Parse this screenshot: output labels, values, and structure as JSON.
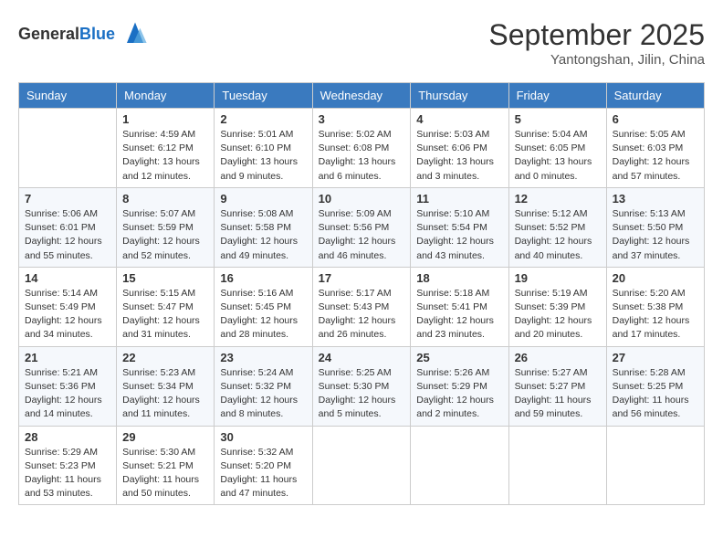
{
  "header": {
    "logo_line1": "General",
    "logo_line2": "Blue",
    "month": "September 2025",
    "location": "Yantongshan, Jilin, China"
  },
  "weekdays": [
    "Sunday",
    "Monday",
    "Tuesday",
    "Wednesday",
    "Thursday",
    "Friday",
    "Saturday"
  ],
  "weeks": [
    [
      {
        "day": "",
        "info": ""
      },
      {
        "day": "1",
        "info": "Sunrise: 4:59 AM\nSunset: 6:12 PM\nDaylight: 13 hours\nand 12 minutes."
      },
      {
        "day": "2",
        "info": "Sunrise: 5:01 AM\nSunset: 6:10 PM\nDaylight: 13 hours\nand 9 minutes."
      },
      {
        "day": "3",
        "info": "Sunrise: 5:02 AM\nSunset: 6:08 PM\nDaylight: 13 hours\nand 6 minutes."
      },
      {
        "day": "4",
        "info": "Sunrise: 5:03 AM\nSunset: 6:06 PM\nDaylight: 13 hours\nand 3 minutes."
      },
      {
        "day": "5",
        "info": "Sunrise: 5:04 AM\nSunset: 6:05 PM\nDaylight: 13 hours\nand 0 minutes."
      },
      {
        "day": "6",
        "info": "Sunrise: 5:05 AM\nSunset: 6:03 PM\nDaylight: 12 hours\nand 57 minutes."
      }
    ],
    [
      {
        "day": "7",
        "info": "Sunrise: 5:06 AM\nSunset: 6:01 PM\nDaylight: 12 hours\nand 55 minutes."
      },
      {
        "day": "8",
        "info": "Sunrise: 5:07 AM\nSunset: 5:59 PM\nDaylight: 12 hours\nand 52 minutes."
      },
      {
        "day": "9",
        "info": "Sunrise: 5:08 AM\nSunset: 5:58 PM\nDaylight: 12 hours\nand 49 minutes."
      },
      {
        "day": "10",
        "info": "Sunrise: 5:09 AM\nSunset: 5:56 PM\nDaylight: 12 hours\nand 46 minutes."
      },
      {
        "day": "11",
        "info": "Sunrise: 5:10 AM\nSunset: 5:54 PM\nDaylight: 12 hours\nand 43 minutes."
      },
      {
        "day": "12",
        "info": "Sunrise: 5:12 AM\nSunset: 5:52 PM\nDaylight: 12 hours\nand 40 minutes."
      },
      {
        "day": "13",
        "info": "Sunrise: 5:13 AM\nSunset: 5:50 PM\nDaylight: 12 hours\nand 37 minutes."
      }
    ],
    [
      {
        "day": "14",
        "info": "Sunrise: 5:14 AM\nSunset: 5:49 PM\nDaylight: 12 hours\nand 34 minutes."
      },
      {
        "day": "15",
        "info": "Sunrise: 5:15 AM\nSunset: 5:47 PM\nDaylight: 12 hours\nand 31 minutes."
      },
      {
        "day": "16",
        "info": "Sunrise: 5:16 AM\nSunset: 5:45 PM\nDaylight: 12 hours\nand 28 minutes."
      },
      {
        "day": "17",
        "info": "Sunrise: 5:17 AM\nSunset: 5:43 PM\nDaylight: 12 hours\nand 26 minutes."
      },
      {
        "day": "18",
        "info": "Sunrise: 5:18 AM\nSunset: 5:41 PM\nDaylight: 12 hours\nand 23 minutes."
      },
      {
        "day": "19",
        "info": "Sunrise: 5:19 AM\nSunset: 5:39 PM\nDaylight: 12 hours\nand 20 minutes."
      },
      {
        "day": "20",
        "info": "Sunrise: 5:20 AM\nSunset: 5:38 PM\nDaylight: 12 hours\nand 17 minutes."
      }
    ],
    [
      {
        "day": "21",
        "info": "Sunrise: 5:21 AM\nSunset: 5:36 PM\nDaylight: 12 hours\nand 14 minutes."
      },
      {
        "day": "22",
        "info": "Sunrise: 5:23 AM\nSunset: 5:34 PM\nDaylight: 12 hours\nand 11 minutes."
      },
      {
        "day": "23",
        "info": "Sunrise: 5:24 AM\nSunset: 5:32 PM\nDaylight: 12 hours\nand 8 minutes."
      },
      {
        "day": "24",
        "info": "Sunrise: 5:25 AM\nSunset: 5:30 PM\nDaylight: 12 hours\nand 5 minutes."
      },
      {
        "day": "25",
        "info": "Sunrise: 5:26 AM\nSunset: 5:29 PM\nDaylight: 12 hours\nand 2 minutes."
      },
      {
        "day": "26",
        "info": "Sunrise: 5:27 AM\nSunset: 5:27 PM\nDaylight: 11 hours\nand 59 minutes."
      },
      {
        "day": "27",
        "info": "Sunrise: 5:28 AM\nSunset: 5:25 PM\nDaylight: 11 hours\nand 56 minutes."
      }
    ],
    [
      {
        "day": "28",
        "info": "Sunrise: 5:29 AM\nSunset: 5:23 PM\nDaylight: 11 hours\nand 53 minutes."
      },
      {
        "day": "29",
        "info": "Sunrise: 5:30 AM\nSunset: 5:21 PM\nDaylight: 11 hours\nand 50 minutes."
      },
      {
        "day": "30",
        "info": "Sunrise: 5:32 AM\nSunset: 5:20 PM\nDaylight: 11 hours\nand 47 minutes."
      },
      {
        "day": "",
        "info": ""
      },
      {
        "day": "",
        "info": ""
      },
      {
        "day": "",
        "info": ""
      },
      {
        "day": "",
        "info": ""
      }
    ]
  ]
}
